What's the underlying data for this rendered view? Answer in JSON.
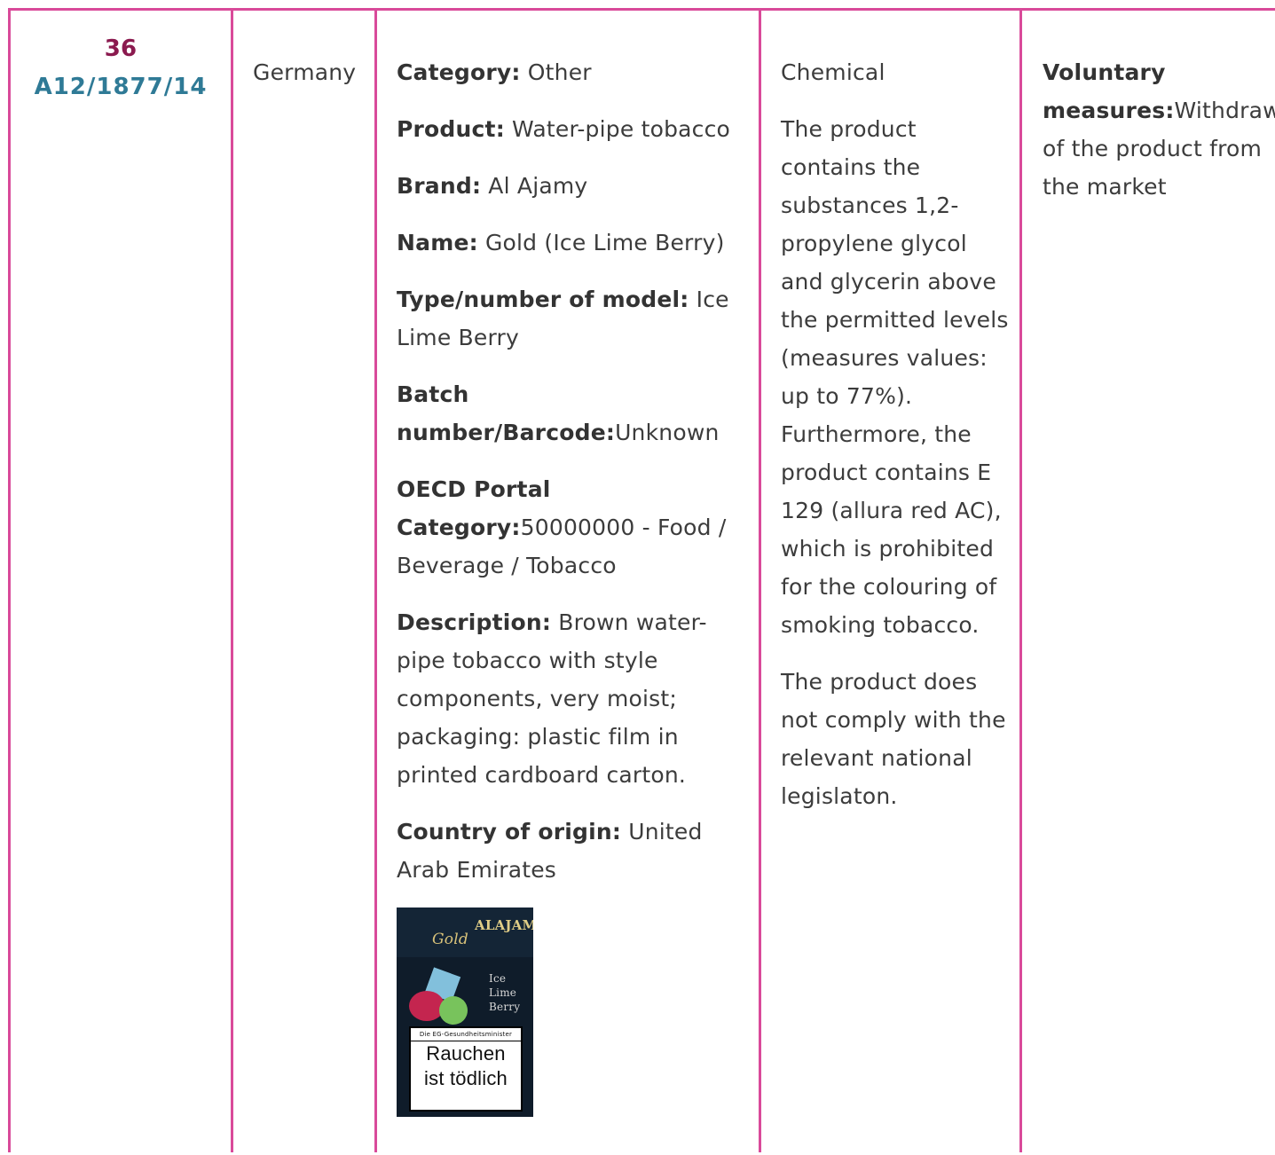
{
  "row": {
    "ref_number": "36",
    "ref_code": "A12/1877/14",
    "country": "Germany",
    "product": {
      "fields": [
        {
          "label": "Category:",
          "value": " Other"
        },
        {
          "label": "Product:",
          "value": " Water-pipe tobacco"
        },
        {
          "label": "Brand:",
          "value": " Al Ajamy"
        },
        {
          "label": "Name:",
          "value": " Gold (Ice Lime Berry)"
        },
        {
          "label": "Type/number of model:",
          "value": " Ice Lime Berry"
        },
        {
          "label": "Batch number/Barcode:",
          "value": "Unknown"
        },
        {
          "label": "OECD Portal Category:",
          "value": "50000000 - Food / Beverage / Tobacco"
        },
        {
          "label": "Description:",
          "value": " Brown water-pipe tobacco with style components, very moist; packaging: plastic film in printed cardboard carton."
        },
        {
          "label": "Country of origin:",
          "value": " United Arab Emirates"
        }
      ],
      "image": {
        "icon": "tobacco-package-photo",
        "brand_text": "ALAJAMY",
        "gold_text": "Gold",
        "flavor_lines": [
          "Ice",
          "Lime",
          "Berry"
        ],
        "warning_header": "Die EG-Gesundheitsminister",
        "warning_lines": [
          "Rauchen",
          "ist tödlich"
        ]
      }
    },
    "risk": {
      "type": "Chemical",
      "paragraphs": [
        "The product contains the substances 1,2-propylene glycol and glycerin above the permitted levels (measures values: up to 77%). Furthermore, the product contains E 129 (allura red AC), which is prohibited for the colouring of smoking tobacco.",
        "The product does not comply with the relevant national legislaton."
      ]
    },
    "measures": {
      "label": "Voluntary measures:",
      "value": "Withdrawal of the product from the market"
    }
  }
}
